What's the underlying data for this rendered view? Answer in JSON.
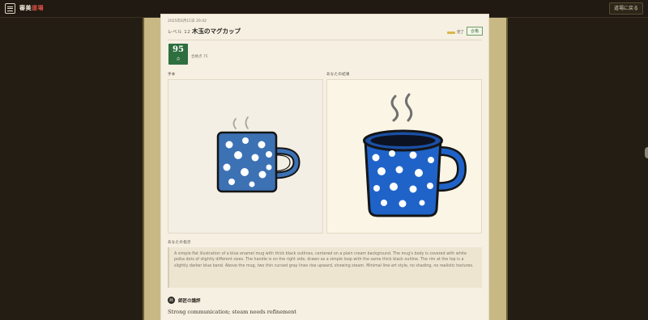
{
  "app": {
    "brand_main": "審美",
    "brand_accent": "道場",
    "back_label": "道場に戻る"
  },
  "entry": {
    "date": "2025年6月11日 20:42",
    "level": "レベル 12",
    "title": "木玉のマグカップ",
    "status_text": "完了",
    "badge": "合格",
    "score": "95",
    "score_unit": "点",
    "score_label": "合格点 75"
  },
  "panels": {
    "reference_label": "手本",
    "result_label": "あなたの結果"
  },
  "prompt": {
    "label": "あなたの指示",
    "text": "A simple flat illustration of a blue enamel mug with thick black outlines, centered on a plain cream background. The mug's body is covered with white polka dots of slightly different sizes. The handle is on the right side, drawn as a simple loop with the same thick black outline. The rim at the top is a slightly darker blue band. Above the mug, two thin curved gray lines rise upward, showing steam. Minimal line-art style, no shading, no realistic textures."
  },
  "master": {
    "icon_text": "師",
    "title": "師匠の講評",
    "comment": "Strong communication; steam needs refinement"
  },
  "colors": {
    "accent": "#e45445",
    "frame": "#c8b883",
    "score_bg": "#2f6e3e",
    "ref_mug": "#3c71b4",
    "result_mug": "#1f63c9"
  }
}
